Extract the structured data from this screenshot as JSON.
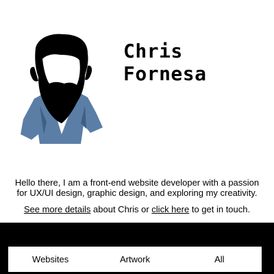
{
  "profile": {
    "first_name": "Chris",
    "last_name": "Fornesa",
    "intro": "Hello there, I am a front-end website developer with a passion for UX/UI design, graphic design, and exploring my creativity.",
    "details_link": "See more details",
    "middle_text": " about Chris or ",
    "contact_link": "click here",
    "end_text": " to get in touch."
  },
  "portrait": {
    "icon": "portrait-illustration",
    "shirt_color": "#5b7ea6",
    "hair_color": "#000000"
  },
  "tabs": [
    {
      "label": "Websites"
    },
    {
      "label": "Artwork"
    },
    {
      "label": "All"
    }
  ],
  "colors": {
    "band": "#000000",
    "background": "#ffffff"
  }
}
